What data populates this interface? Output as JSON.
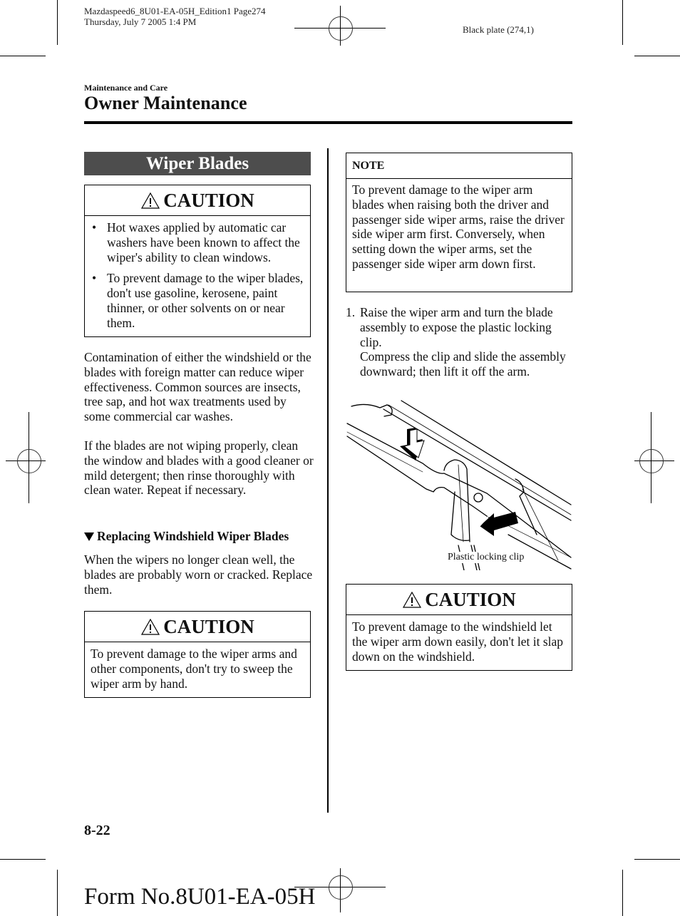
{
  "print_meta": {
    "file_line": "Mazdaspeed6_8U01-EA-05H_Edition1 Page274",
    "date_line": "Thursday, July 7 2005 1:4 PM",
    "plate": "Black plate (274,1)"
  },
  "header": {
    "section": "Maintenance and Care",
    "title": "Owner Maintenance"
  },
  "left_column": {
    "heading": "Wiper Blades",
    "caution1": {
      "icon": "warning-triangle-icon",
      "title": "CAUTION",
      "bullets": [
        "Hot waxes applied by automatic car washers have been known to affect the wiper's ability to clean windows.",
        "To prevent damage to the wiper blades, don't use gasoline, kerosene, paint thinner, or other solvents on or near them."
      ]
    },
    "para1": "Contamination of either the windshield or the blades with foreign matter can reduce wiper effectiveness. Common sources are insects, tree sap, and hot wax treatments used by some commercial car washes.",
    "para2": "If the blades are not wiping properly, clean the window and blades with a good cleaner or mild detergent; then rinse thoroughly with clean water. Repeat if necessary.",
    "subheading": "Replacing Windshield Wiper Blades",
    "para3": "When the wipers no longer clean well, the blades are probably worn or cracked. Replace them.",
    "caution2": {
      "icon": "warning-triangle-icon",
      "title": "CAUTION",
      "text": "To prevent damage to the wiper arms and other components, don't try to sweep the wiper arm by hand."
    }
  },
  "right_column": {
    "note": {
      "title": "NOTE",
      "text": "To prevent damage to the wiper arm blades when raising both the driver and passenger side wiper arms, raise the driver side wiper arm first. Conversely, when setting down the wiper arms, set the passenger side wiper arm down first."
    },
    "step1": {
      "number": "1.",
      "line1": "Raise the wiper arm and turn the blade assembly to expose the plastic locking clip.",
      "line2": "Compress the clip and slide the assembly downward; then lift it off the arm."
    },
    "illustration": {
      "description": "wiper-arm-and-blade-diagram",
      "callout": "Plastic locking clip"
    },
    "caution3": {
      "icon": "warning-triangle-icon",
      "title": "CAUTION",
      "text": "To prevent damage to the windshield let the wiper arm down easily, don't let it slap down on the windshield."
    }
  },
  "footer": {
    "page_number": "8-22",
    "form_number": "Form No.8U01-EA-05H"
  }
}
